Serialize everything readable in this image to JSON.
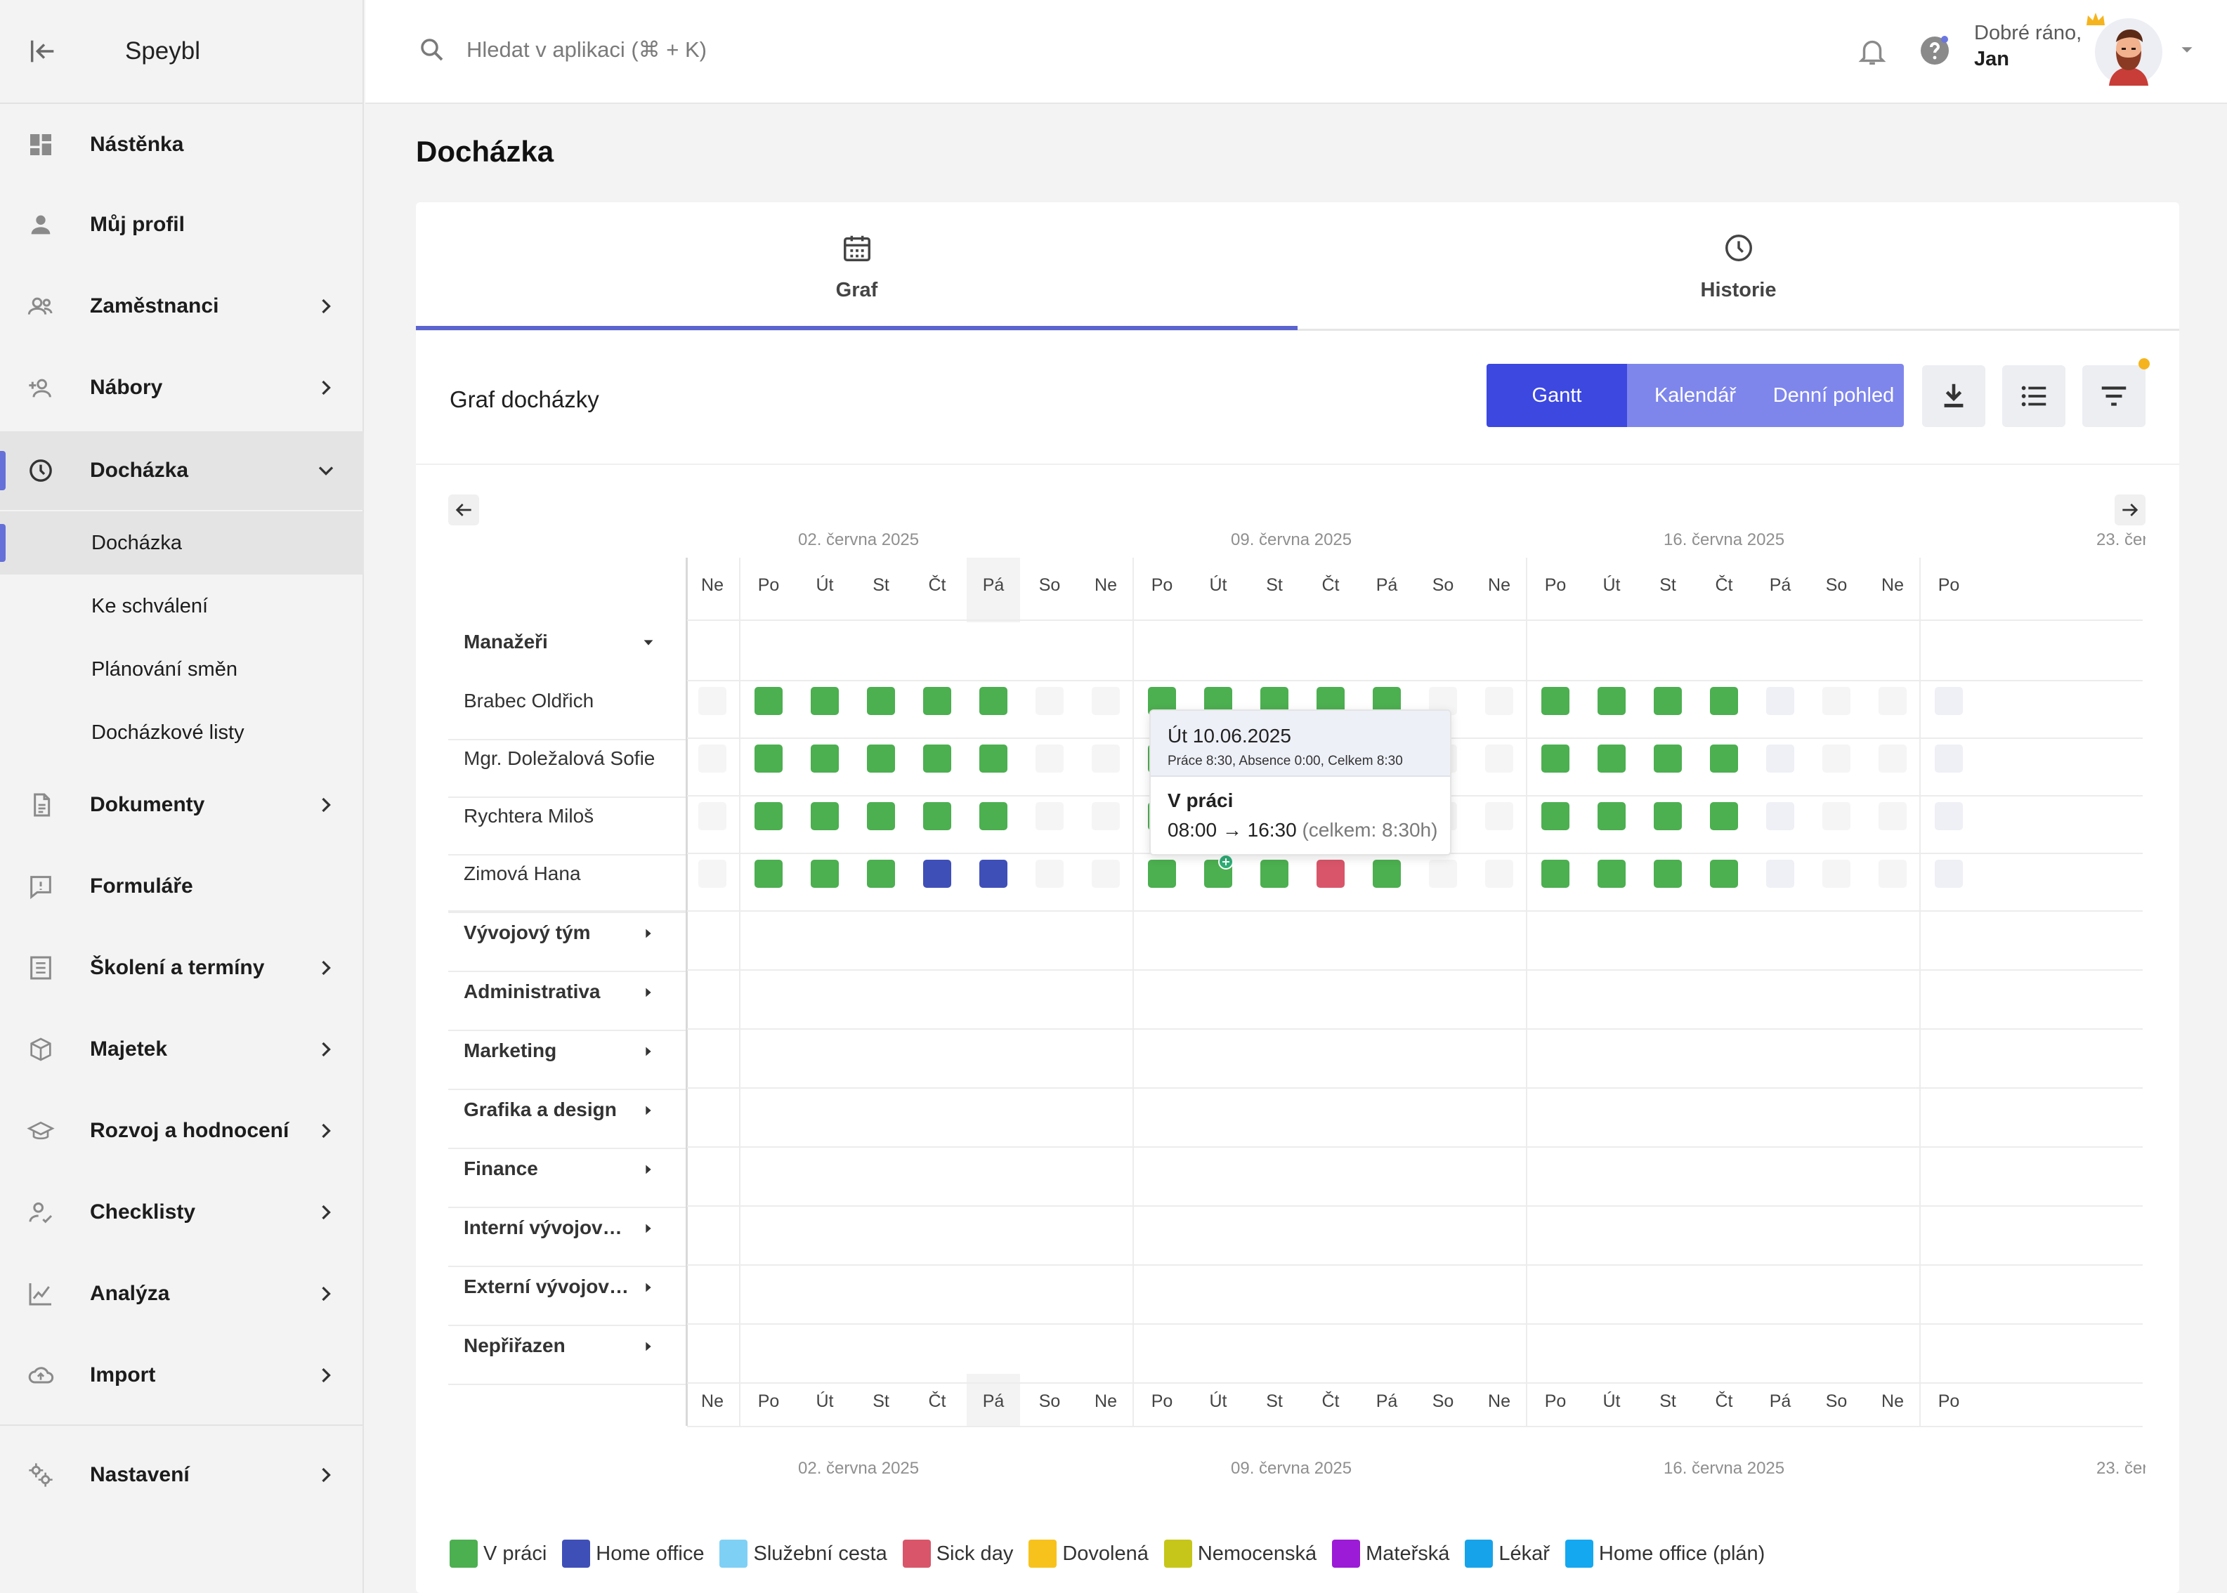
{
  "app": {
    "name": "Speybl"
  },
  "search": {
    "placeholder": "Hledat v aplikaci (⌘ + K)"
  },
  "user": {
    "greeting": "Dobré ráno,",
    "name": "Jan"
  },
  "sidebar": {
    "items": [
      {
        "label": "Nástěnka",
        "icon": "dashboard-icon"
      },
      {
        "label": "Můj profil",
        "icon": "person-icon"
      },
      {
        "label": "Zaměstnanci",
        "icon": "people-icon"
      },
      {
        "label": "Nábory",
        "icon": "person-add-icon"
      },
      {
        "label": "Docházka",
        "icon": "clock-icon"
      },
      {
        "label": "Dokumenty",
        "icon": "document-icon"
      },
      {
        "label": "Formuláře",
        "icon": "form-icon"
      },
      {
        "label": "Školení a termíny",
        "icon": "list-icon"
      },
      {
        "label": "Majetek",
        "icon": "box-icon"
      },
      {
        "label": "Rozvoj a hodnocení",
        "icon": "graduation-icon"
      },
      {
        "label": "Checklisty",
        "icon": "person-check-icon"
      },
      {
        "label": "Analýza",
        "icon": "chart-icon"
      },
      {
        "label": "Import",
        "icon": "cloud-upload-icon"
      },
      {
        "label": "Nastavení",
        "icon": "gear-icon"
      }
    ],
    "subitems": [
      {
        "label": "Docházka"
      },
      {
        "label": "Ke schválení"
      },
      {
        "label": "Plánování směn"
      },
      {
        "label": "Docházkové listy"
      }
    ]
  },
  "page": {
    "title": "Docházka"
  },
  "tabs": [
    {
      "label": "Graf"
    },
    {
      "label": "Historie"
    }
  ],
  "toolbar": {
    "title": "Graf docházky",
    "views": [
      {
        "label": "Gantt"
      },
      {
        "label": "Kalendář"
      },
      {
        "label": "Denní pohled"
      }
    ]
  },
  "gantt": {
    "week_labels": [
      "02. června 2025",
      "09. června 2025",
      "16. června 2025",
      "23. čer"
    ],
    "day_labels": [
      "Ne",
      "Po",
      "Út",
      "St",
      "Čt",
      "Pá",
      "So",
      "Ne",
      "Po",
      "Út",
      "St",
      "Čt",
      "Pá",
      "So",
      "Ne",
      "Po",
      "Út",
      "St",
      "Čt",
      "Pá",
      "So",
      "Ne",
      "Po"
    ],
    "highlight_day_index": 5,
    "manager_group": "Manažeři",
    "rows": [
      {
        "name": "Brabec Oldřich",
        "cells": [
          "empty",
          "work",
          "work",
          "work",
          "work",
          "work",
          "empty",
          "empty",
          "work",
          "work",
          "work",
          "work",
          "work",
          "empty",
          "empty",
          "work",
          "work",
          "work",
          "work",
          "future",
          "empty",
          "empty",
          "future"
        ]
      },
      {
        "name": "Mgr. Doležalová Sofie",
        "cells": [
          "empty",
          "work",
          "work",
          "work",
          "work",
          "work",
          "empty",
          "empty",
          "work",
          "work",
          "work",
          "work",
          "work",
          "empty",
          "empty",
          "work",
          "work",
          "work",
          "work",
          "future",
          "empty",
          "empty",
          "future"
        ]
      },
      {
        "name": "Rychtera Miloš",
        "cells": [
          "empty",
          "work",
          "work",
          "work",
          "work",
          "work",
          "empty",
          "empty",
          "work",
          "work",
          "work",
          "work",
          "work",
          "empty",
          "empty",
          "work",
          "work",
          "work",
          "work",
          "future",
          "empty",
          "empty",
          "future"
        ]
      },
      {
        "name": "Zimová Hana",
        "cells": [
          "empty",
          "work",
          "work",
          "work",
          "home",
          "home",
          "empty",
          "empty",
          "work",
          "work",
          "work",
          "sick",
          "work",
          "empty",
          "empty",
          "work",
          "work",
          "work",
          "work",
          "future",
          "empty",
          "empty",
          "future"
        ]
      }
    ],
    "groups": [
      "Vývojový tým",
      "Administrativa",
      "Marketing",
      "Grafika a design",
      "Finance",
      "Interní vývojový tým",
      "Externí vývojový tým",
      "Nepřiřazen"
    ]
  },
  "tooltip": {
    "date": "Út 10.06.2025",
    "summary": "Práce 8:30, Absence 0:00, Celkem 8:30",
    "status": "V práci",
    "time": "08:00 → 16:30",
    "total": "(celkem: 8:30h)"
  },
  "legend": [
    {
      "label": "V práci",
      "color": "#4caf50"
    },
    {
      "label": "Home office",
      "color": "#3f4fb8"
    },
    {
      "label": "Služební cesta",
      "color": "#7fd0f5"
    },
    {
      "label": "Sick day",
      "color": "#d9566a"
    },
    {
      "label": "Dovolená",
      "color": "#f7c21c"
    },
    {
      "label": "Nemocenská",
      "color": "#c6c61a"
    },
    {
      "label": "Mateřská",
      "color": "#9b1bd6"
    },
    {
      "label": "Lékař",
      "color": "#17a3ea"
    },
    {
      "label": "Home office (plán)",
      "color": "#14a8f0"
    }
  ],
  "colors": {
    "accent": "#3c48e0",
    "accent_light": "#7e86ec",
    "work": "#4caf50",
    "home": "#3f4fb8",
    "sick": "#d9566a"
  }
}
